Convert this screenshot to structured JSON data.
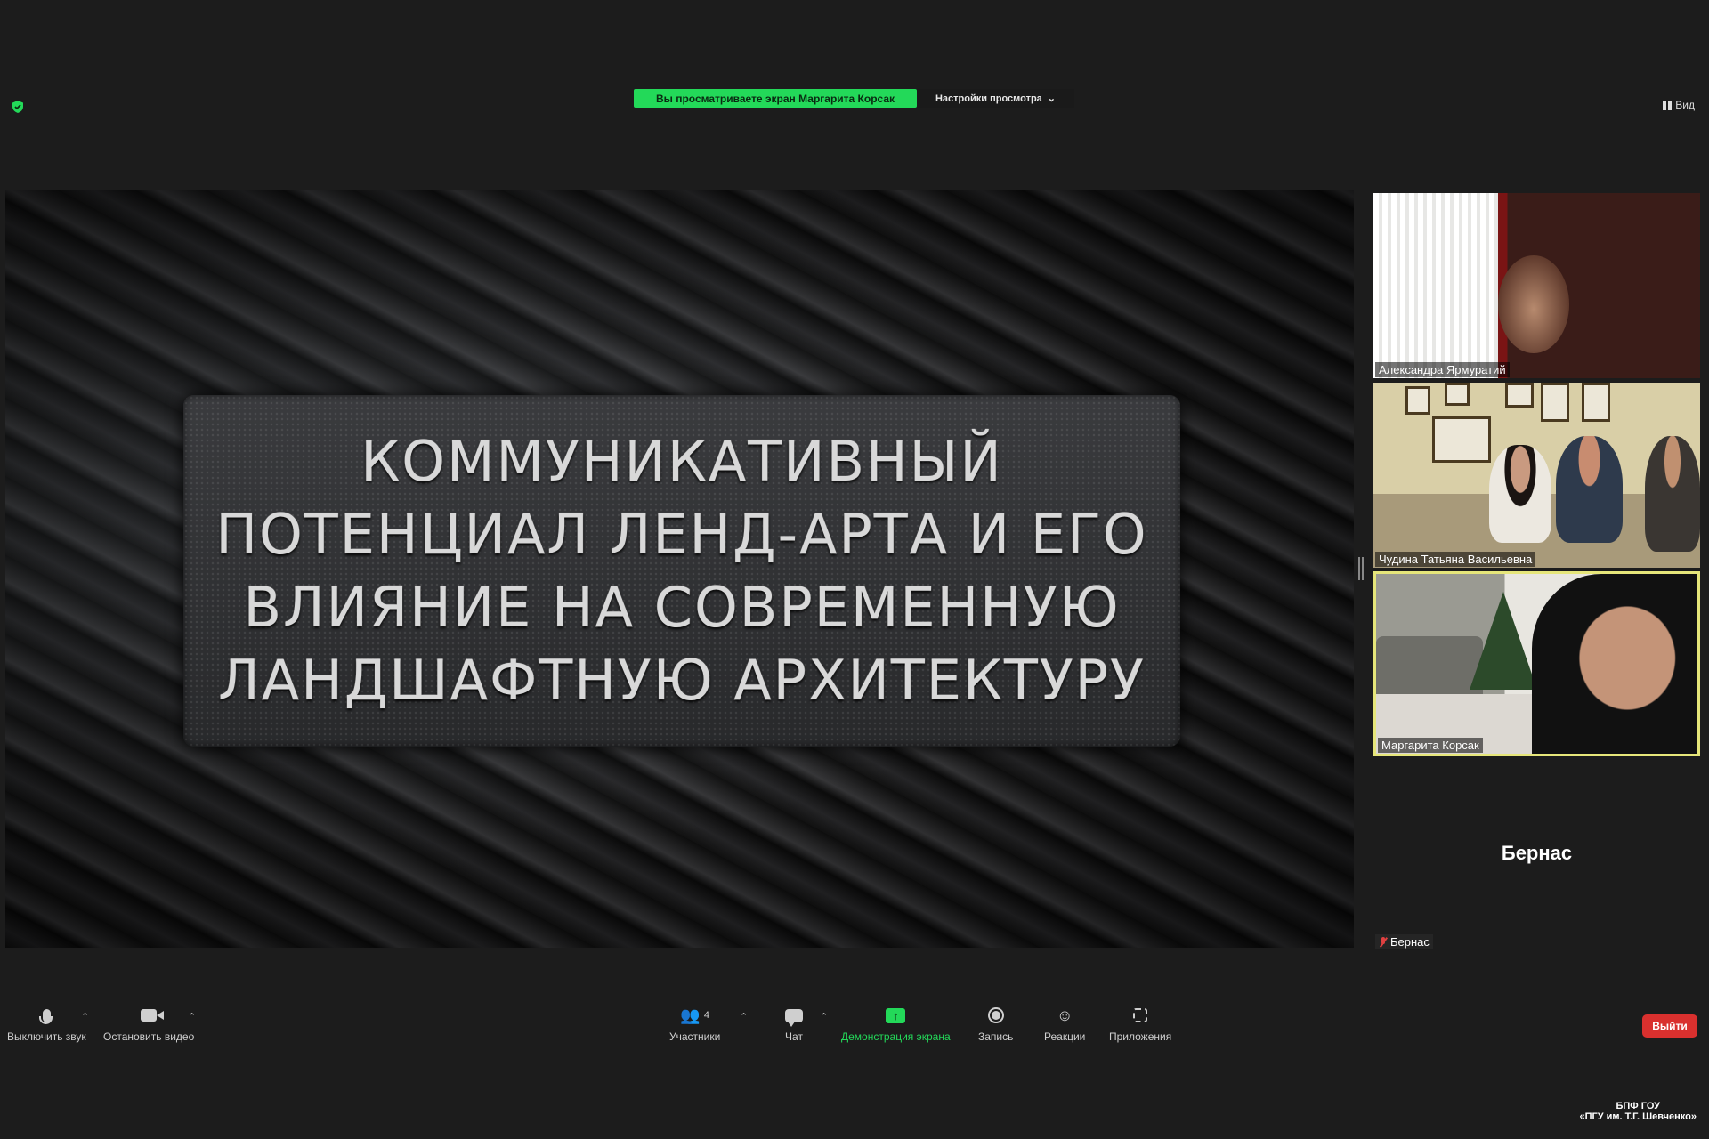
{
  "top_bar": {
    "share_banner": "Вы просматриваете экран Маргарита Корсак",
    "view_options": "Настройки просмотра",
    "view_menu": "Вид"
  },
  "slide": {
    "title_lines": [
      "КОММУНИКАТИВНЫЙ",
      "ПОТЕНЦИАЛ ЛЕНД-АРТА И ЕГО",
      "ВЛИЯНИЕ НА СОВРЕМЕННУЮ",
      "ЛАНДШАФТНУЮ  АРХИТЕКТУРУ"
    ]
  },
  "participants": [
    {
      "name": "Александра Ярмуратий"
    },
    {
      "name": "Чудина Татьяна Васильевна"
    },
    {
      "name": "Маргарита Корсак"
    },
    {
      "name": "Бернас",
      "display_name": "Бернас"
    }
  ],
  "toolbar": {
    "mute": "Выключить звук",
    "stop_video": "Остановить видео",
    "participants": "Участники",
    "participants_count": "4",
    "chat": "Чат",
    "share_screen": "Демонстрация экрана",
    "record": "Запись",
    "reactions": "Реакции",
    "apps": "Приложения",
    "leave": "Выйти"
  },
  "watermark": {
    "line1": "БПФ ГОУ",
    "line2": "«ПГУ им. Т.Г. Шевченко»"
  },
  "colors": {
    "share_green": "#23d959",
    "leave_red": "#d9302e",
    "active_speaker": "#e6e67a"
  }
}
